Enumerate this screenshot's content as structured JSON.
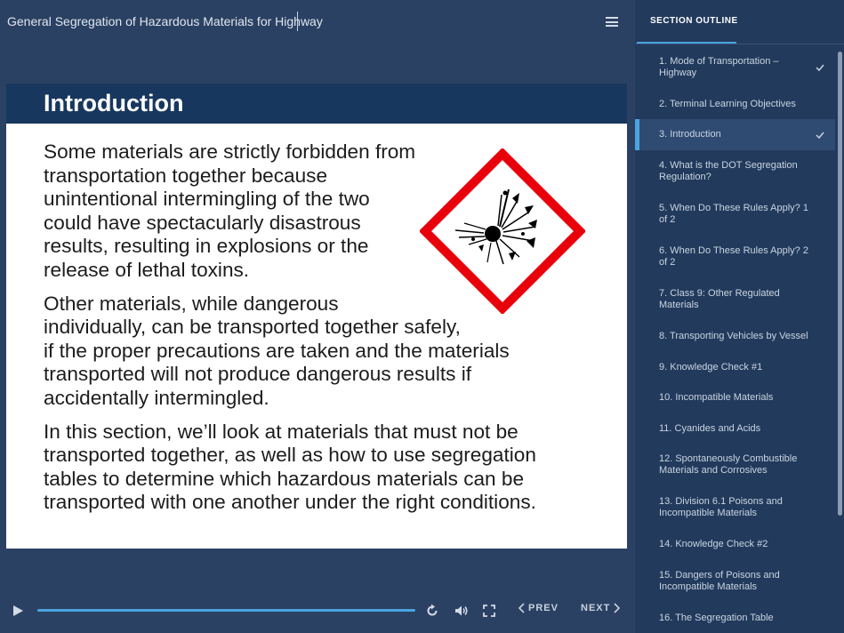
{
  "header": {
    "course_title": "General Segregation of Hazardous Materials for Highway",
    "menu_icon": "hamburger-menu-icon"
  },
  "slide": {
    "title": "Introduction",
    "paragraphs": [
      "Some materials are strictly forbidden from\ntransportation together because\nunintentional intermingling of the two\ncould have spectacularly disastrous\nresults, resulting in explosions or the\nrelease of lethal toxins.",
      "Other materials, while dangerous\nindividually, can be transported together safely,\nif the proper precautions are taken and the materials\ntransported will not produce dangerous results if\naccidentally intermingled.",
      "In this section, we’ll look at materials that must not be\ntransported together, as well as how to use segregation\ntables to determine which hazardous materials can be\ntransported with one another under the right conditions."
    ],
    "pictogram": "explosive-hazard-pictogram",
    "pictogram_colors": {
      "border": "#e8000b",
      "symbol": "#000000"
    }
  },
  "player": {
    "prev_label": "PREV",
    "next_label": "NEXT",
    "accent_color": "#4aa4e0"
  },
  "sidebar": {
    "tab_label": "SECTION OUTLINE",
    "items": [
      {
        "label": "1. Mode of Transportation –\nHighway",
        "completed": true,
        "active": false
      },
      {
        "label": "2. Terminal Learning Objectives",
        "completed": false,
        "active": false
      },
      {
        "label": "3. Introduction",
        "completed": true,
        "active": true
      },
      {
        "label": "4. What is the DOT Segregation\nRegulation?",
        "completed": false,
        "active": false
      },
      {
        "label": "5. When Do These Rules Apply? 1\nof 2",
        "completed": false,
        "active": false
      },
      {
        "label": "6. When Do These Rules Apply? 2\nof 2",
        "completed": false,
        "active": false
      },
      {
        "label": "7. Class 9: Other Regulated\nMaterials",
        "completed": false,
        "active": false
      },
      {
        "label": "8. Transporting Vehicles by Vessel",
        "completed": false,
        "active": false
      },
      {
        "label": "9. Knowledge Check #1",
        "completed": false,
        "active": false
      },
      {
        "label": "10. Incompatible Materials",
        "completed": false,
        "active": false
      },
      {
        "label": "11. Cyanides and Acids",
        "completed": false,
        "active": false
      },
      {
        "label": "12. Spontaneously Combustible\nMaterials and Corrosives",
        "completed": false,
        "active": false
      },
      {
        "label": "13. Division 6.1 Poisons and\nIncompatible Materials",
        "completed": false,
        "active": false
      },
      {
        "label": "14. Knowledge Check #2",
        "completed": false,
        "active": false
      },
      {
        "label": "15. Dangers of Poisons and\nIncompatible Materials",
        "completed": false,
        "active": false
      },
      {
        "label": "16. The Segregation Table",
        "completed": false,
        "active": false
      }
    ]
  }
}
